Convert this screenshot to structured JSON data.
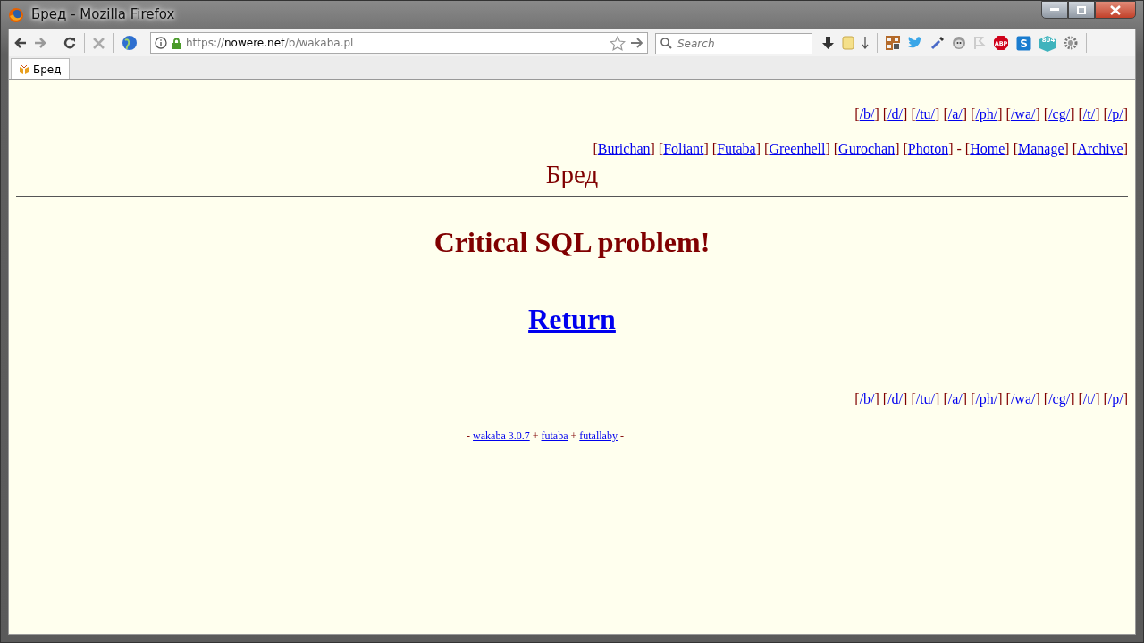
{
  "window": {
    "title": "Бред - Mozilla Firefox"
  },
  "toolbar": {
    "url": {
      "scheme": "https://",
      "host": "nowere.net",
      "path": "/b/wakaba.pl"
    },
    "search": {
      "placeholder": "Search"
    },
    "badges": {
      "adblock": "ABP",
      "skype": "S",
      "counter": "804"
    }
  },
  "tabs": [
    {
      "label": "Бред",
      "selected": true
    }
  ],
  "page": {
    "boards_top": [
      {
        "open": "[",
        "label": "/b/",
        "close": "]"
      },
      {
        "open": "[",
        "label": "/d/",
        "close": "]"
      },
      {
        "open": "[",
        "label": "/tu/",
        "close": "]"
      },
      {
        "open": "[",
        "label": "/a/",
        "close": "]"
      },
      {
        "open": "[",
        "label": "/ph/",
        "close": "]"
      },
      {
        "open": "[",
        "label": "/wa/",
        "close": "]"
      },
      {
        "open": "[",
        "label": "/cg/",
        "close": "]"
      },
      {
        "open": "[",
        "label": "/t/",
        "close": "]"
      },
      {
        "open": "[",
        "label": "/p/",
        "close": "]"
      }
    ],
    "styles_nav": [
      {
        "kind": "link",
        "open": "[",
        "label": "Burichan",
        "close": "]"
      },
      {
        "kind": "link",
        "open": "[",
        "label": "Foliant",
        "close": "]"
      },
      {
        "kind": "link",
        "open": "[",
        "label": "Futaba",
        "close": "]"
      },
      {
        "kind": "link",
        "open": "[",
        "label": "Greenhell",
        "close": "]"
      },
      {
        "kind": "link",
        "open": "[",
        "label": "Gurochan",
        "close": "]"
      },
      {
        "kind": "link",
        "open": "[",
        "label": "Photon",
        "close": "]"
      },
      {
        "kind": "text",
        "label": "-"
      },
      {
        "kind": "link",
        "open": "[",
        "label": "Home",
        "close": "]"
      },
      {
        "kind": "link",
        "open": "[",
        "label": "Manage",
        "close": "]"
      },
      {
        "kind": "link",
        "open": "[",
        "label": "Archive",
        "close": "]"
      }
    ],
    "board_title": "Бред",
    "error": "Critical SQL problem!",
    "return_link": "Return",
    "boards_bottom": [
      {
        "open": "[",
        "label": "/b/",
        "close": "]"
      },
      {
        "open": "[",
        "label": "/d/",
        "close": "]"
      },
      {
        "open": "[",
        "label": "/tu/",
        "close": "]"
      },
      {
        "open": "[",
        "label": "/a/",
        "close": "]"
      },
      {
        "open": "[",
        "label": "/ph/",
        "close": "]"
      },
      {
        "open": "[",
        "label": "/wa/",
        "close": "]"
      },
      {
        "open": "[",
        "label": "/cg/",
        "close": "]"
      },
      {
        "open": "[",
        "label": "/t/",
        "close": "]"
      },
      {
        "open": "[",
        "label": "/p/",
        "close": "]"
      }
    ],
    "footer": [
      {
        "kind": "text",
        "label": "-"
      },
      {
        "kind": "link",
        "label": "wakaba 3.0.7"
      },
      {
        "kind": "text",
        "label": "+"
      },
      {
        "kind": "link",
        "label": "futaba"
      },
      {
        "kind": "text",
        "label": "+"
      },
      {
        "kind": "link",
        "label": "futallaby"
      },
      {
        "kind": "text",
        "label": "-"
      }
    ]
  }
}
